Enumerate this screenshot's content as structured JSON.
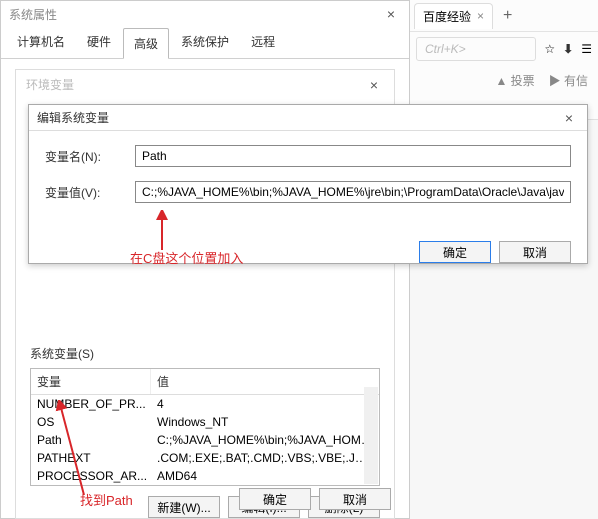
{
  "main_window": {
    "title": "系统属性",
    "close_icon": "×",
    "tabs": [
      "计算机名",
      "硬件",
      "高级",
      "系统保护",
      "远程"
    ],
    "active_tab_index": 2,
    "inner_title": "环境变量",
    "sys_vars_label": "系统变量(S)",
    "table": {
      "headers": [
        "变量",
        "值"
      ],
      "rows": [
        {
          "name": "NUMBER_OF_PR...",
          "value": "4"
        },
        {
          "name": "OS",
          "value": "Windows_NT"
        },
        {
          "name": "Path",
          "value": "C:;%JAVA_HOME%\\bin;%JAVA_HOME%\\..."
        },
        {
          "name": "PATHEXT",
          "value": ".COM;.EXE;.BAT;.CMD;.VBS;.VBE;.JS;.JSE;..."
        },
        {
          "name": "PROCESSOR_AR...",
          "value": "AMD64"
        }
      ]
    },
    "buttons": {
      "new": "新建(W)...",
      "edit": "编辑(I)...",
      "delete": "删除(L)"
    },
    "bottom": {
      "ok": "确定",
      "cancel": "取消"
    }
  },
  "modal": {
    "title": "编辑系统变量",
    "close_icon": "×",
    "name_label": "变量名(N):",
    "name_value": "Path",
    "value_label": "变量值(V):",
    "value_value": "C:;%JAVA_HOME%\\bin;%JAVA_HOME%\\jre\\bin;\\ProgramData\\Oracle\\Java\\javapath;%S",
    "ok": "确定",
    "cancel": "取消"
  },
  "annotations": {
    "top": "在C盘这个位置加入",
    "bottom": "找到Path"
  },
  "browser": {
    "tab_label": "百度经验",
    "tab_close": "×",
    "plus": "+",
    "addr_hint": "Ctrl+K>",
    "star": "☆",
    "menu": "☰",
    "like": "▲ 投票",
    "tip": "▶ 有信"
  }
}
